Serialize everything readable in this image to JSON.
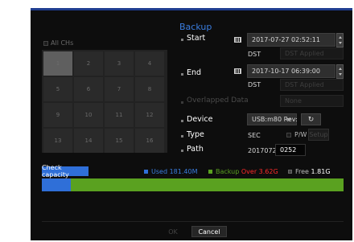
{
  "title": "Backup",
  "channels": {
    "all_label": "All CHs",
    "cells": [
      "1",
      "2",
      "3",
      "4",
      "5",
      "6",
      "7",
      "8",
      "9",
      "10",
      "11",
      "12",
      "13",
      "14",
      "15",
      "16"
    ]
  },
  "start": {
    "label": "Start",
    "datetime": "2017-07-27  02:52:11",
    "dst_label": "DST",
    "dst_value": "DST Applied"
  },
  "end": {
    "label": "End",
    "datetime": "2017-10-17  06:39:00",
    "dst_label": "DST",
    "dst_value": "DST Applied"
  },
  "overlapped": {
    "label": "Overlapped Data",
    "value": "None"
  },
  "device": {
    "label": "Device",
    "value": "USB:m80 Rev:"
  },
  "type": {
    "label": "Type",
    "value": "SEC",
    "pw_label": "P/W",
    "setup_label": "Setup"
  },
  "path": {
    "label": "Path",
    "prefix": "20170727",
    "value": "0252"
  },
  "capacity": {
    "button_label": "Check capacity",
    "used_label": "Used",
    "used_value": "181.40M",
    "backup_label": "Backup",
    "backup_value": "Over 3.62G",
    "free_label": "Free",
    "free_value": "1.81G",
    "used_fraction": 0.095,
    "colors": {
      "used": "#2f6fd8",
      "backup": "#5aa120",
      "over": "#ff2a2a"
    }
  },
  "footer": {
    "ok_label": "OK",
    "cancel_label": "Cancel"
  }
}
